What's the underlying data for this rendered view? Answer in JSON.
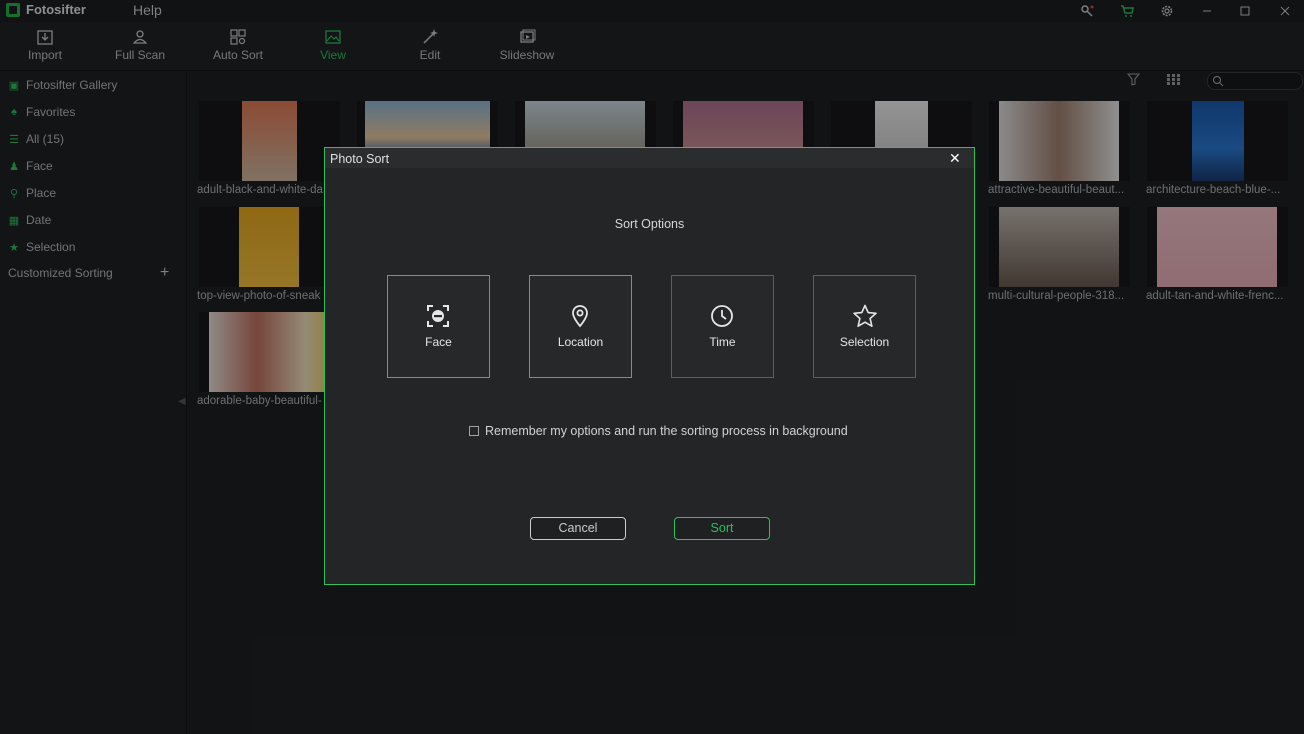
{
  "app": {
    "name": "Fotosifter",
    "menu_help": "Help"
  },
  "toolbar": [
    {
      "label": "Import"
    },
    {
      "label": "Full Scan"
    },
    {
      "label": "Auto Sort"
    },
    {
      "label": "View"
    },
    {
      "label": "Edit"
    },
    {
      "label": "Slideshow"
    }
  ],
  "sidebar": {
    "items": [
      {
        "label": "Fotosifter Gallery",
        "icon": "gallery-icon"
      },
      {
        "label": "Favorites",
        "icon": "favorites-icon"
      },
      {
        "label": "All (15)",
        "icon": "list-icon"
      },
      {
        "label": "Face",
        "icon": "face-icon"
      },
      {
        "label": "Place",
        "icon": "place-icon"
      },
      {
        "label": "Date",
        "icon": "date-icon"
      },
      {
        "label": "Selection",
        "icon": "selection-icon"
      }
    ],
    "customized_sorting": "Customized Sorting"
  },
  "gallery": {
    "row1_labels": [
      "adult-black-and-white-da",
      "attractive-beautiful-beaut...",
      "architecture-beach-blue-..."
    ],
    "row2_labels": [
      "top-view-photo-of-sneak",
      "multi-cultural-people-318...",
      "adult-tan-and-white-frenc..."
    ],
    "row3_labels": [
      "adorable-baby-beautiful-"
    ]
  },
  "dialog": {
    "title": "Photo Sort",
    "heading": "Sort Options",
    "options": [
      {
        "label": "Face",
        "selected": true,
        "icon": "face-scan-icon"
      },
      {
        "label": "Location",
        "selected": true,
        "icon": "location-pin-icon"
      },
      {
        "label": "Time",
        "selected": false,
        "icon": "clock-icon"
      },
      {
        "label": "Selection",
        "selected": false,
        "icon": "star-icon"
      }
    ],
    "remember_label": "Remember my options and run the sorting process in background",
    "remember_checked": false,
    "cancel_label": "Cancel",
    "sort_label": "Sort"
  },
  "colors": {
    "accent": "#2fbf5e",
    "background": "#1e2023"
  }
}
